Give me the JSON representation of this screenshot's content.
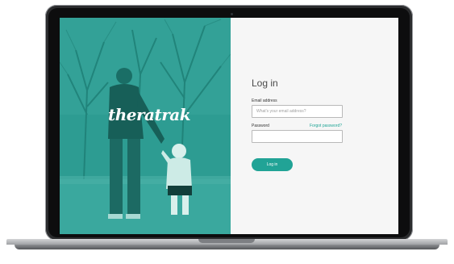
{
  "brand": {
    "logo_text": "theratrak"
  },
  "login": {
    "title": "Log in",
    "email_label": "Email address",
    "email_placeholder": "What's your email address?",
    "password_label": "Password",
    "forgot_link": "Forgot password?",
    "password_value": "",
    "submit_label": "Log in"
  },
  "colors": {
    "accent": "#21a396",
    "hero_overlay": "#2a9a90",
    "panel_bg": "#f6f6f6"
  }
}
